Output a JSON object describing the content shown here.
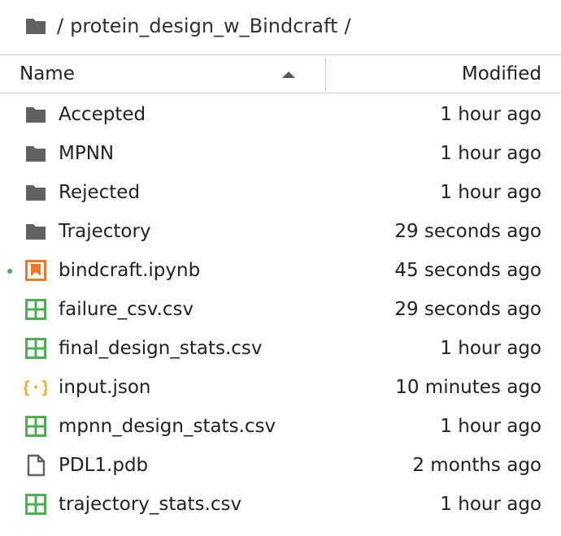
{
  "breadcrumb": {
    "separator": "/",
    "path": "protein_design_w_Bindcraft",
    "trailing": "/"
  },
  "header": {
    "name_label": "Name",
    "modified_label": "Modified",
    "sort": "ascending"
  },
  "colors": {
    "folder": "#616161",
    "notebook": "#f37626",
    "csv": "#4caf50",
    "json": "#f9a825",
    "file": "#616161",
    "running_dot": "#4caf50"
  },
  "files": [
    {
      "name": "Accepted",
      "modified": "1 hour ago",
      "type": "folder",
      "icon": "folder-icon"
    },
    {
      "name": "MPNN",
      "modified": "1 hour ago",
      "type": "folder",
      "icon": "folder-icon"
    },
    {
      "name": "Rejected",
      "modified": "1 hour ago",
      "type": "folder",
      "icon": "folder-icon"
    },
    {
      "name": "Trajectory",
      "modified": "29 seconds ago",
      "type": "folder",
      "icon": "folder-icon"
    },
    {
      "name": "bindcraft.ipynb",
      "modified": "45 seconds ago",
      "type": "notebook",
      "icon": "notebook-icon",
      "running": true
    },
    {
      "name": "failure_csv.csv",
      "modified": "29 seconds ago",
      "type": "csv",
      "icon": "spreadsheet-icon"
    },
    {
      "name": "final_design_stats.csv",
      "modified": "1 hour ago",
      "type": "csv",
      "icon": "spreadsheet-icon"
    },
    {
      "name": "input.json",
      "modified": "10 minutes ago",
      "type": "json",
      "icon": "json-icon"
    },
    {
      "name": "mpnn_design_stats.csv",
      "modified": "1 hour ago",
      "type": "csv",
      "icon": "spreadsheet-icon"
    },
    {
      "name": "PDL1.pdb",
      "modified": "2 months ago",
      "type": "file",
      "icon": "file-icon"
    },
    {
      "name": "trajectory_stats.csv",
      "modified": "1 hour ago",
      "type": "csv",
      "icon": "spreadsheet-icon"
    }
  ]
}
